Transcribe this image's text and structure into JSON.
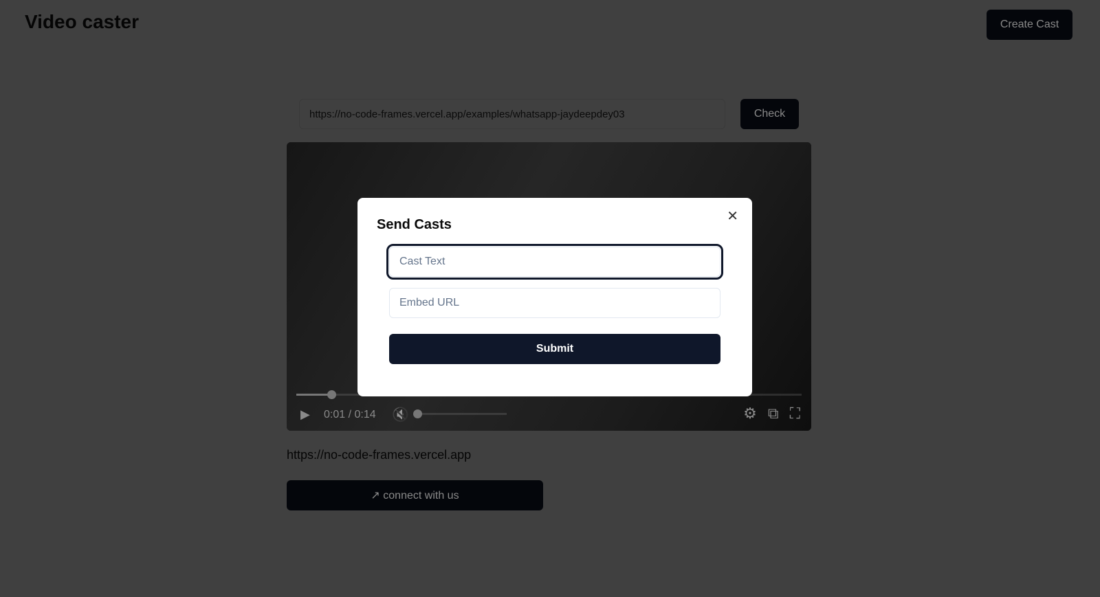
{
  "header": {
    "title": "Video caster",
    "create_label": "Create Cast"
  },
  "url_input": {
    "value": "https://no-code-frames.vercel.app/examples/whatsapp-jaydeepdey03",
    "check_label": "Check"
  },
  "video": {
    "current_time": "0:01",
    "duration": "0:14",
    "time_display": "0:01 / 0:14",
    "progress_percent": 7,
    "muted": true,
    "volume": 0
  },
  "frame_link": "https://no-code-frames.vercel.app",
  "connect_label": "connect with us",
  "modal": {
    "title": "Send Casts",
    "cast_text_placeholder": "Cast Text",
    "embed_url_placeholder": "Embed URL",
    "submit_label": "Submit",
    "close_icon": "close-icon"
  }
}
